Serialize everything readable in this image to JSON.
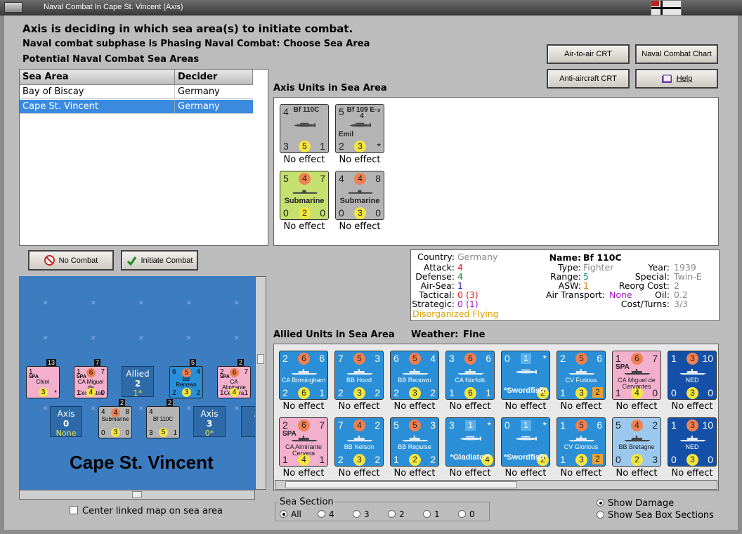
{
  "window": {
    "title": "Naval Combat In Cape St. Vincent (Axis)"
  },
  "headings": {
    "line1": "Axis is deciding in which sea area(s) to initiate combat.",
    "line2": "Naval combat subphase is Phasing Naval Combat: Choose Sea Area",
    "line3": "Potential Naval Combat Sea Areas"
  },
  "crt_buttons": {
    "air_to_air": "Air-to-air CRT",
    "naval_chart": "Naval Combat Chart",
    "anti_aircraft": "Anti-aircraft CRT",
    "help": "Help"
  },
  "sea_table": {
    "columns": [
      "Sea Area",
      "Decider"
    ],
    "rows": [
      {
        "area": "Bay of Biscay",
        "decider": "Germany"
      },
      {
        "area": "Cape St. Vincent",
        "decider": "Germany"
      }
    ]
  },
  "axis_section": {
    "title": "Axis Units in Sea Area"
  },
  "axis_units": [
    {
      "name": "Bf 110C",
      "tl": "4",
      "bl": "3",
      "bm": "5",
      "br": "1",
      "color": "#b4b4b4",
      "effect": "No effect",
      "kind": "plane"
    },
    {
      "name": "Bf 109 E-4",
      "sub": "Emil",
      "tl": "5",
      "tr": "*",
      "bl": "2",
      "bm": "3",
      "br": "*",
      "color": "#b4b4b4",
      "effect": "No effect",
      "kind": "plane"
    },
    {
      "name": "Submarine",
      "tl": "5",
      "tm": "4",
      "tr": "7",
      "bl": "0",
      "bm": "2",
      "br": "0",
      "color": "#c6e070",
      "effect": "No effect",
      "kind": "sub"
    },
    {
      "name": "Submarine",
      "tl": "4",
      "tm": "4",
      "tr": "8",
      "bl": "0",
      "bm": "3",
      "br": "0",
      "color": "#b4b4b4",
      "effect": "No effect",
      "kind": "sub"
    }
  ],
  "actions": {
    "no_combat": "No Combat",
    "initiate": "Initiate Combat"
  },
  "unit_details": {
    "country_label": "Country:",
    "country": "Germany",
    "attack_label": "Attack:",
    "attack": "4",
    "defense_label": "Defense:",
    "defense": "4",
    "airsea_label": "Air-Sea:",
    "airsea": "1",
    "tactical_label": "Tactical:",
    "tactical": "0",
    "tactical_paren": "(3)",
    "strategic_label": "Strategic:",
    "strategic": "0",
    "strategic_paren": "(1)",
    "status": "Disorganized Flying",
    "name_label": "Name:",
    "name": "Bf 110C",
    "type_label": "Type:",
    "type": "Fighter",
    "range_label": "Range:",
    "range": "5",
    "asw_label": "ASW:",
    "asw": "1",
    "air_transport_label": "Air Transport:",
    "air_transport": "None",
    "year_label": "Year:",
    "year": "1939",
    "special_label": "Special:",
    "special": "Twin-E",
    "reorg_label": "Reorg Cost:",
    "reorg": "2",
    "oil_label": "Oil:",
    "oil": "0.2",
    "cost_label": "Cost/Turns:",
    "cost": "3/3"
  },
  "allied_section": {
    "title": "Allied Units in Sea Area",
    "weather_label": "Weather:",
    "weather": "Fine"
  },
  "allied_units": [
    {
      "name": "CA Birmingham",
      "tl": "2",
      "tm": "6",
      "tr": "6",
      "bl": "2",
      "bm": "6",
      "br": "1",
      "color": "#2a8fd6",
      "effect": "No effect",
      "kind": "ship"
    },
    {
      "name": "BB Hood",
      "tl": "7",
      "tm": "5",
      "tr": "3",
      "bl": "2",
      "bm": "3",
      "br": "2",
      "color": "#2a8fd6",
      "effect": "No effect",
      "kind": "ship"
    },
    {
      "name": "BB Renown",
      "tl": "6",
      "tm": "5",
      "tr": "4",
      "bl": "2",
      "bm": "3",
      "br": "2",
      "color": "#2a8fd6",
      "effect": "No effect",
      "kind": "ship"
    },
    {
      "name": "CA Norfolk",
      "tl": "3",
      "tm": "6",
      "tr": "6",
      "bl": "1",
      "bm": "6",
      "br": "1",
      "color": "#2a8fd6",
      "effect": "No effect",
      "kind": "ship"
    },
    {
      "name": "*Swordfish*",
      "tl": "0",
      "tm": "1",
      "tr": "*",
      "bl": "",
      "bm": "2",
      "br": "*",
      "color": "#2a8fd6",
      "effect": "No effect",
      "kind": "plane"
    },
    {
      "name": "CV Furious",
      "tl": "2",
      "tm": "5",
      "tr": "6",
      "bl": "1",
      "bm": "3",
      "br": "2",
      "color": "#2a8fd6",
      "effect": "No effect",
      "kind": "ship"
    },
    {
      "name": "CA Miguel de Cervantes",
      "sub": "SPA",
      "tl": "1",
      "tm": "6",
      "tr": "7",
      "bl": "1",
      "bm": "4",
      "br": "0",
      "color": "#f2b0cc",
      "effect": "No effect",
      "kind": "ship"
    },
    {
      "name": "NED",
      "tl": "1",
      "tm": "3",
      "tr": "10",
      "bl": "0",
      "bm": "3",
      "br": "0",
      "color": "#1550a8",
      "effect": "No effect",
      "kind": "ship"
    },
    {
      "name": "CA Almirante Cervera",
      "sub": "SPA",
      "tl": "2",
      "tm": "6",
      "tr": "7",
      "bl": "1",
      "bm": "4",
      "br": "1",
      "color": "#f2b0cc",
      "effect": "No effect",
      "kind": "ship"
    },
    {
      "name": "BB Nelson",
      "tl": "7",
      "tm": "4",
      "tr": "2",
      "bl": "2",
      "bm": "3",
      "br": "2",
      "color": "#2a8fd6",
      "effect": "No effect",
      "kind": "ship"
    },
    {
      "name": "BB Repulse",
      "tl": "5",
      "tm": "5",
      "tr": "3",
      "bl": "1",
      "bm": "2",
      "br": "2",
      "color": "#2a8fd6",
      "effect": "No effect",
      "kind": "ship"
    },
    {
      "name": "*Gladiator*",
      "tl": "3",
      "tm": "1",
      "tr": "*",
      "bl": "",
      "bm": "4",
      "br": "",
      "color": "#2a8fd6",
      "effect": "No effect",
      "kind": "plane"
    },
    {
      "name": "*Swordfish*",
      "tl": "0",
      "tm": "1",
      "tr": "*",
      "bl": "",
      "bm": "2",
      "br": "*",
      "color": "#2a8fd6",
      "effect": "No effect",
      "kind": "plane"
    },
    {
      "name": "CV Glorious",
      "tl": "1",
      "tm": "5",
      "tr": "6",
      "bl": "1",
      "bm": "3",
      "br": "2",
      "color": "#2a8fd6",
      "effect": "No effect",
      "kind": "ship"
    },
    {
      "name": "BB Bretagne",
      "tl": "5",
      "tm": "4",
      "tr": "2",
      "bl": "0",
      "bm": "2",
      "br": "3",
      "color": "#9dc8ee",
      "effect": "No effect",
      "kind": "ship"
    },
    {
      "name": "NED",
      "tl": "1",
      "tm": "3",
      "tr": "10",
      "bl": "0",
      "bm": "3",
      "br": "0",
      "color": "#1550a8",
      "effect": "No effect",
      "kind": "ship"
    }
  ],
  "map": {
    "sea_name": "Cape St. Vincent",
    "counters": [
      {
        "label": "Chirri",
        "sub": "SPA",
        "top": "13",
        "tl": "1",
        "bm": "3",
        "br": "*",
        "color": "#f2b0cc"
      },
      {
        "label": "CA Miguel de Cervantes",
        "sub": "SPA",
        "top": "7",
        "tl": "1",
        "tm": "6",
        "tr": "7",
        "bl": "1",
        "bm": "4",
        "br": "0",
        "color": "#f2b0cc"
      },
      {
        "label": "BB Renown",
        "top": "5",
        "tl": "6",
        "tm": "5",
        "tr": "4",
        "bl": "2",
        "bm": "3",
        "br": "2",
        "color": "#2a8fd6"
      },
      {
        "label": "CA Almirante Cervera",
        "sub": "SPA",
        "top": "2",
        "tl": "2",
        "tm": "6",
        "tr": "7",
        "bl": "1",
        "bm": "4",
        "br": "1",
        "color": "#f2b0cc"
      },
      {
        "label": "Submarine",
        "top": "2",
        "tl": "4",
        "tm": "4",
        "tr": "8",
        "bl": "0",
        "bm": "3",
        "br": "0",
        "color": "#b4b4b4"
      },
      {
        "label": "Bf 110C",
        "top": "2",
        "tl": "4",
        "bl": "3",
        "bm": "5",
        "br": "1",
        "color": "#b4b4b4"
      }
    ],
    "boxes": [
      {
        "title": "Allied",
        "value": "2",
        "note": "1*"
      },
      {
        "title": "Axis",
        "value": "0",
        "note": "None"
      },
      {
        "title": "Axis",
        "value": "3",
        "note": "0*"
      },
      {
        "title": "A",
        "value": "",
        "note": ""
      }
    ]
  },
  "center_map_label": "Center linked map on sea area",
  "sea_section": {
    "title": "Sea Section",
    "options": [
      "All",
      "4",
      "3",
      "2",
      "1",
      "0"
    ]
  },
  "display": {
    "show_damage": "Show Damage",
    "show_sea_box": "Show Sea Box Sections"
  }
}
